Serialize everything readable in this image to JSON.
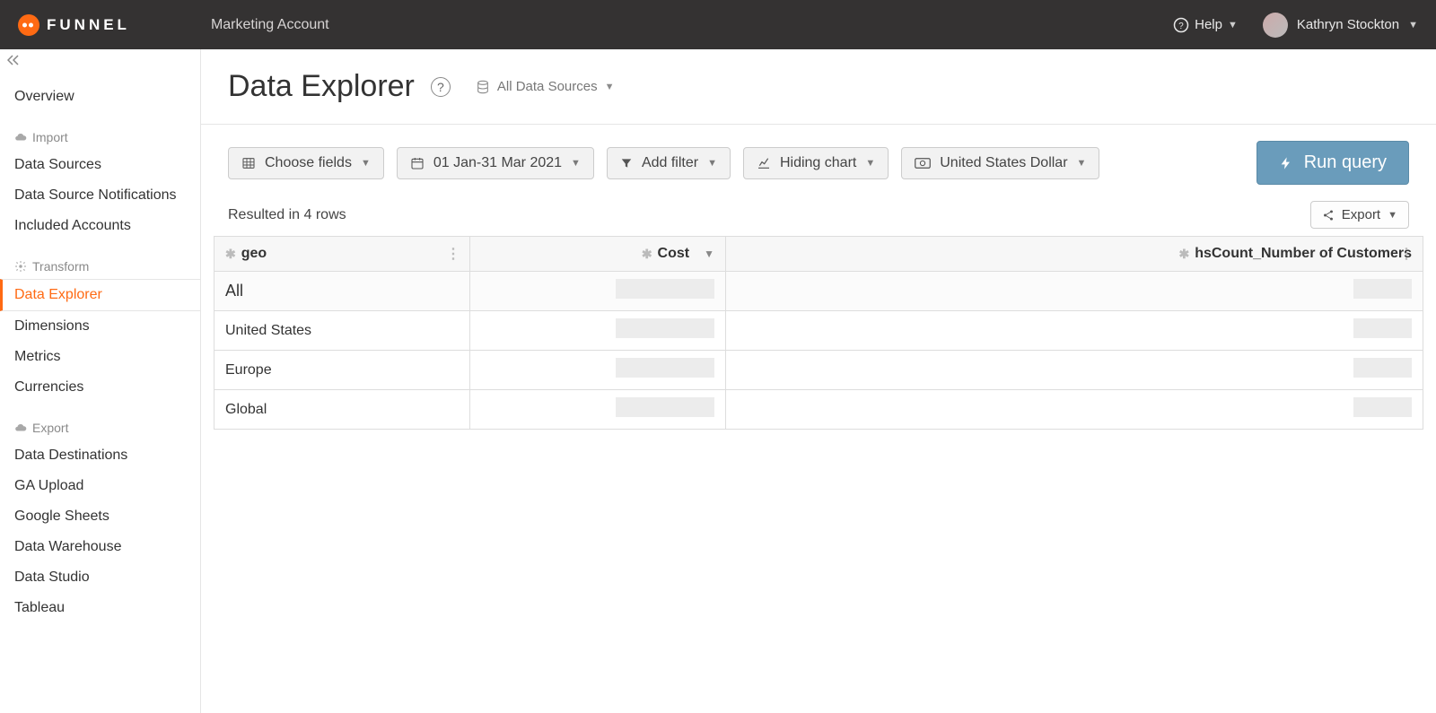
{
  "header": {
    "brand": "FUNNEL",
    "account": "Marketing Account",
    "help_label": "Help",
    "user_name": "Kathryn Stockton"
  },
  "sidebar": {
    "overview": "Overview",
    "groups": [
      {
        "title": "Import",
        "items": [
          "Data Sources",
          "Data Source Notifications",
          "Included Accounts"
        ]
      },
      {
        "title": "Transform",
        "items": [
          "Data Explorer",
          "Dimensions",
          "Metrics",
          "Currencies"
        ],
        "active_index": 0
      },
      {
        "title": "Export",
        "items": [
          "Data Destinations",
          "GA Upload",
          "Google Sheets",
          "Data Warehouse",
          "Data Studio",
          "Tableau"
        ]
      }
    ]
  },
  "page": {
    "title": "Data Explorer",
    "data_source_label": "All Data Sources"
  },
  "toolbar": {
    "fields": "Choose fields",
    "date_range": "01 Jan-31 Mar 2021",
    "filter": "Add filter",
    "chart": "Hiding chart",
    "currency": "United States Dollar",
    "run": "Run query"
  },
  "results": {
    "summary": "Resulted in 4 rows",
    "export_label": "Export",
    "columns": {
      "c1": "geo",
      "c2": "Cost",
      "c3": "hsCount_Number of Customers"
    },
    "sort": {
      "column": "c2",
      "dir": "desc"
    },
    "rows": [
      {
        "geo": "All",
        "cost": "",
        "customers": "",
        "is_all": true
      },
      {
        "geo": "United States",
        "cost": "",
        "customers": ""
      },
      {
        "geo": "Europe",
        "cost": "",
        "customers": ""
      },
      {
        "geo": "Global",
        "cost": "",
        "customers": ""
      }
    ]
  }
}
